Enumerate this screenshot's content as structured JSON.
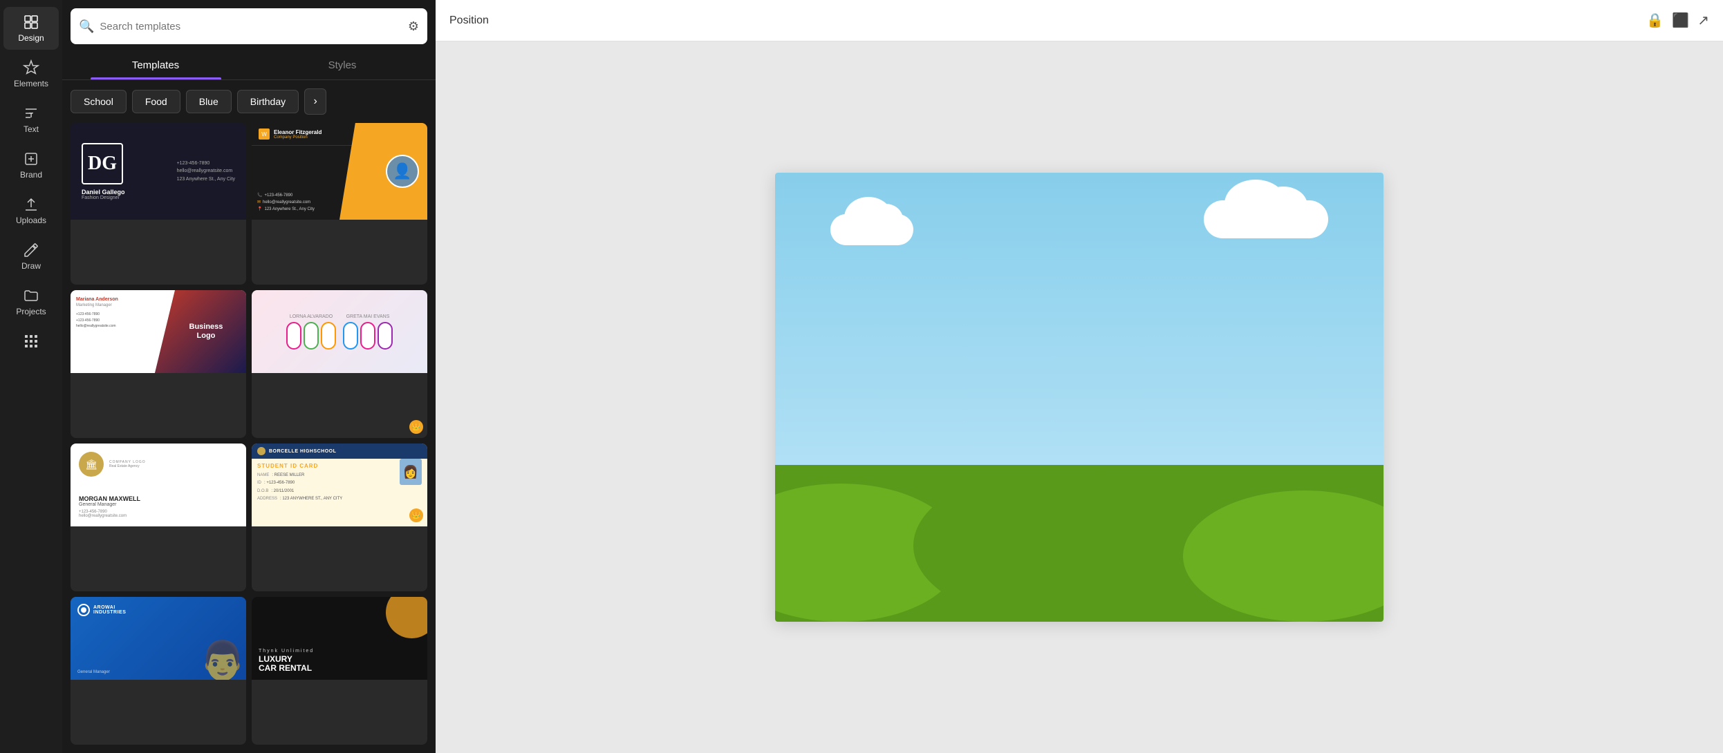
{
  "sidebar": {
    "items": [
      {
        "id": "design",
        "label": "Design",
        "icon": "design",
        "active": true
      },
      {
        "id": "elements",
        "label": "Elements",
        "icon": "elements",
        "active": false
      },
      {
        "id": "text",
        "label": "Text",
        "icon": "text",
        "active": false
      },
      {
        "id": "brand",
        "label": "Brand",
        "icon": "brand",
        "active": false
      },
      {
        "id": "uploads",
        "label": "Uploads",
        "icon": "uploads",
        "active": false
      },
      {
        "id": "draw",
        "label": "Draw",
        "icon": "draw",
        "active": false
      },
      {
        "id": "projects",
        "label": "Projects",
        "icon": "projects",
        "active": false
      },
      {
        "id": "apps",
        "label": "Apps",
        "icon": "apps",
        "active": false
      }
    ]
  },
  "panel": {
    "search_placeholder": "Search templates",
    "tabs": [
      {
        "id": "templates",
        "label": "Templates",
        "active": true
      },
      {
        "id": "styles",
        "label": "Styles",
        "active": false
      }
    ],
    "categories": [
      {
        "id": "school",
        "label": "School"
      },
      {
        "id": "food",
        "label": "Food"
      },
      {
        "id": "blue",
        "label": "Blue"
      },
      {
        "id": "birthday",
        "label": "Birthday"
      }
    ],
    "templates": [
      {
        "id": 1,
        "type": "dg-card",
        "name": "Daniel Gallego Fashion Designer",
        "premium": false
      },
      {
        "id": 2,
        "type": "eleanor-card",
        "name": "Eleanor Fitzgerald Company Position",
        "premium": false
      },
      {
        "id": 3,
        "type": "mariana-card",
        "name": "Mariana Anderson Business Logo",
        "premium": false
      },
      {
        "id": 4,
        "type": "colorful-card",
        "name": "Lorna Alvarado colorful card",
        "premium": true
      },
      {
        "id": 5,
        "type": "morgan-card",
        "name": "Morgan Maxwell General Manager Real Estate",
        "premium": false
      },
      {
        "id": 6,
        "type": "student-card",
        "name": "Borcelle Highschool Student ID Card",
        "premium": true
      },
      {
        "id": 7,
        "type": "arowai-card",
        "name": "Arowai Industries",
        "premium": false
      },
      {
        "id": 8,
        "type": "luxury-card",
        "name": "Thynk Unlimited Luxury Car Rental",
        "premium": false
      }
    ]
  },
  "topbar": {
    "title": "Position"
  },
  "canvas": {
    "scene": "sky and hills landscape"
  }
}
